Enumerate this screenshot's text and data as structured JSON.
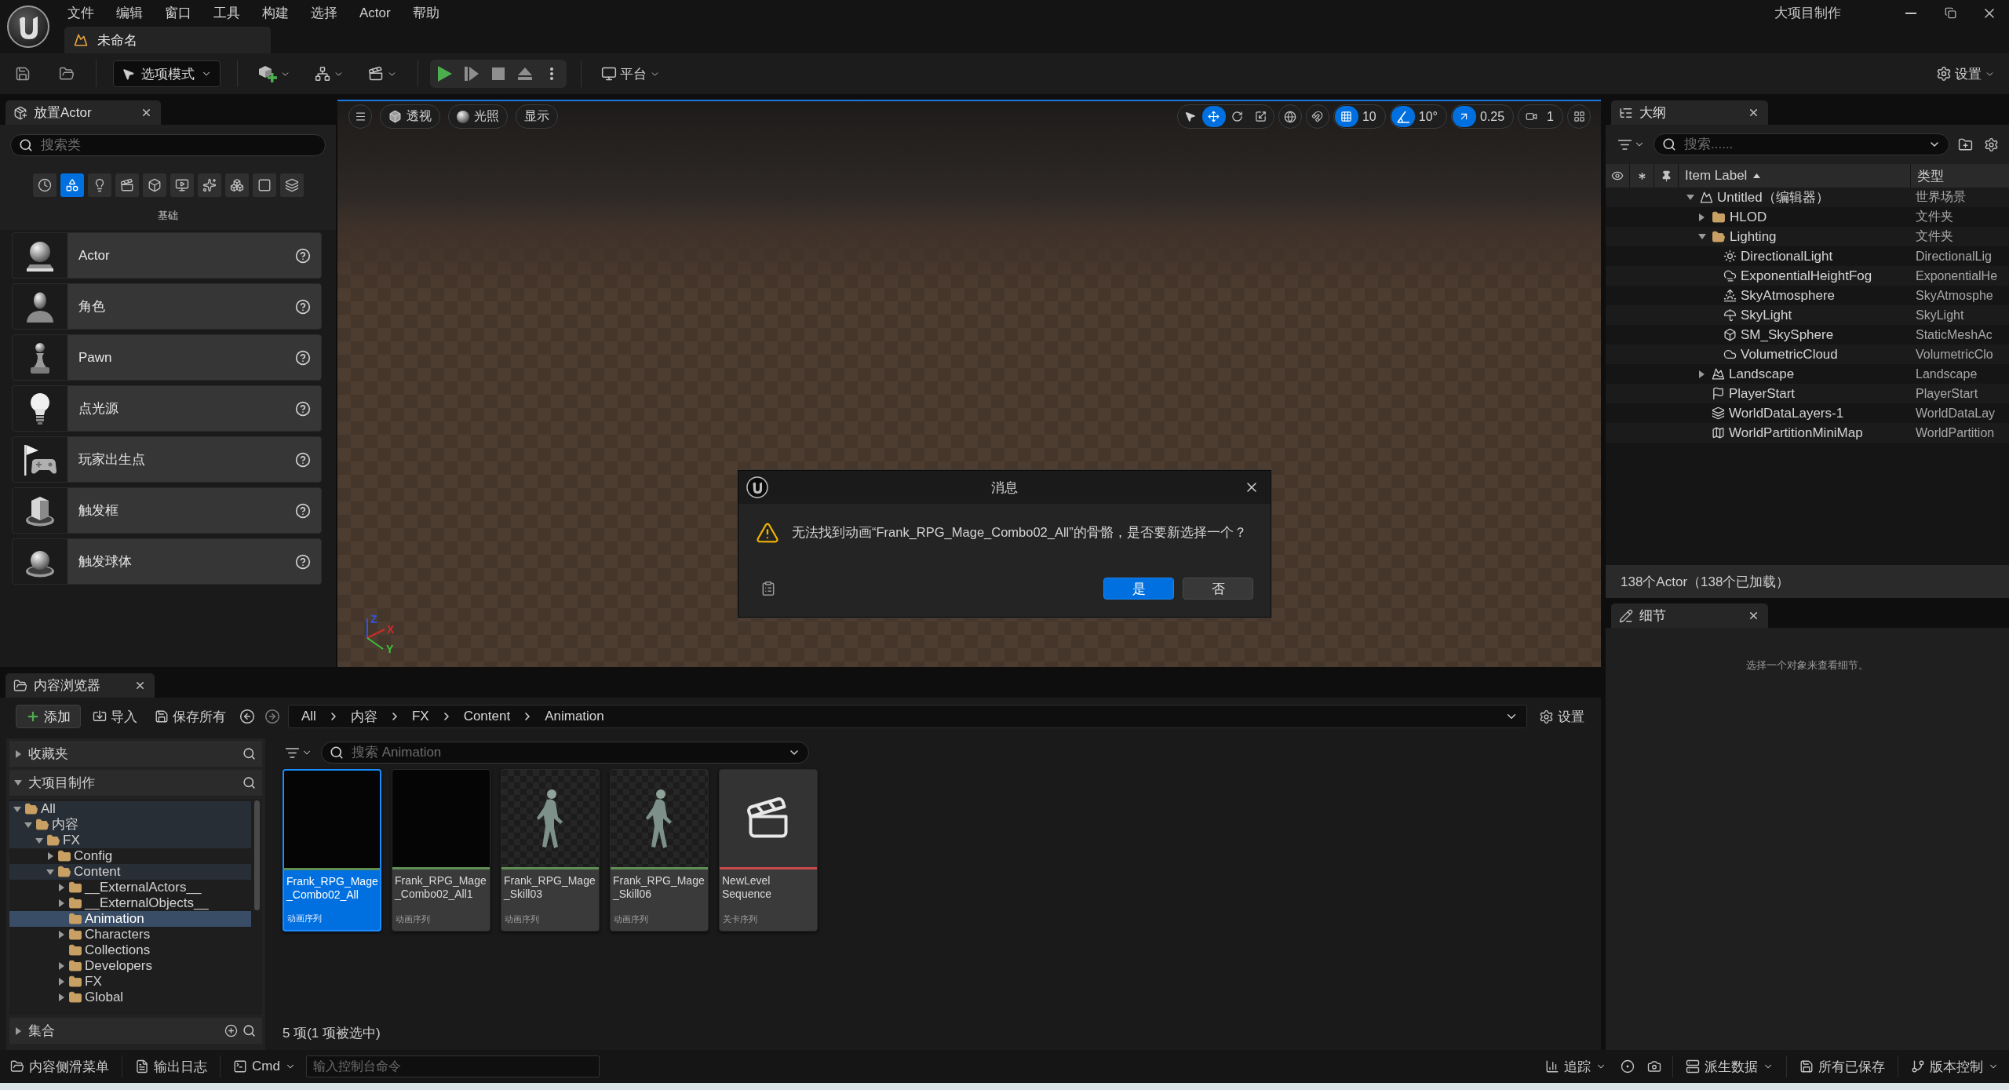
{
  "title_bar": {
    "menu": [
      "文件",
      "编辑",
      "窗口",
      "工具",
      "构建",
      "选择",
      "Actor",
      "帮助"
    ],
    "project": "大项目制作",
    "document_tab": "未命名"
  },
  "toolbar": {
    "mode": "选项模式",
    "platform": "平台",
    "settings": "设置"
  },
  "place_actors": {
    "tab": "放置Actor",
    "search_placeholder": "搜索类",
    "categories": [
      {
        "kind": "recent",
        "selected": false
      },
      {
        "kind": "basic",
        "selected": true
      },
      {
        "kind": "lights",
        "selected": false
      },
      {
        "kind": "cinematic",
        "selected": false
      },
      {
        "kind": "visual",
        "selected": false
      },
      {
        "kind": "media",
        "selected": false
      },
      {
        "kind": "effects",
        "selected": false
      },
      {
        "kind": "geometry",
        "selected": false
      },
      {
        "kind": "volumes",
        "selected": false
      },
      {
        "kind": "classes",
        "selected": false
      }
    ],
    "category_label": "基础",
    "items": [
      {
        "label": "Actor",
        "kind": "actor"
      },
      {
        "label": "角色",
        "kind": "character"
      },
      {
        "label": "Pawn",
        "kind": "pawn"
      },
      {
        "label": "点光源",
        "kind": "pointlight"
      },
      {
        "label": "玩家出生点",
        "kind": "playerstart"
      },
      {
        "label": "触发框",
        "kind": "triggerbox"
      },
      {
        "label": "触发球体",
        "kind": "triggersphere"
      }
    ]
  },
  "viewport": {
    "view_buttons": [
      {
        "kind": "perspective",
        "label": "透视"
      },
      {
        "kind": "lighting",
        "label": "光照"
      },
      {
        "kind": "show",
        "label": "显示"
      }
    ],
    "transform_tools": [
      {
        "kind": "select",
        "selected": false
      },
      {
        "kind": "move",
        "selected": true
      },
      {
        "kind": "rotate",
        "selected": false
      },
      {
        "kind": "scale",
        "selected": false
      }
    ],
    "snaps": [
      {
        "kind": "grid",
        "on": true,
        "value": "10"
      },
      {
        "kind": "angle",
        "on": true,
        "value": "10°"
      },
      {
        "kind": "scale",
        "on": true,
        "value": "0.25"
      },
      {
        "kind": "camera",
        "on": false,
        "value": "1"
      }
    ],
    "axis_labels": [
      "Z",
      "X",
      "Y"
    ],
    "dialog": {
      "title": "消息",
      "message": "无法找到动画“Frank_RPG_Mage_Combo02_All”的骨骼，是否要新选择一个？",
      "buttons": [
        {
          "label": "是",
          "kind": "primary"
        },
        {
          "label": "否",
          "kind": "secondary"
        }
      ]
    }
  },
  "outliner": {
    "tab": "大纲",
    "search_placeholder": "搜索......",
    "columns": [
      {
        "label": "Item Label",
        "sort_ascending": true
      },
      {
        "label": "类型"
      }
    ],
    "items": [
      {
        "label": "Untitled（编辑器）",
        "type": "世界场景",
        "kind": "world",
        "expanded": true,
        "children": [
          {
            "label": "HLOD",
            "type": "文件夹",
            "kind": "folder",
            "expanded": false
          },
          {
            "label": "Lighting",
            "type": "文件夹",
            "kind": "folder",
            "expanded": true,
            "children": [
              {
                "label": "DirectionalLight",
                "type": "DirectionalLig",
                "kind": "directional"
              },
              {
                "label": "ExponentialHeightFog",
                "type": "ExponentialHe",
                "kind": "fog"
              },
              {
                "label": "SkyAtmosphere",
                "type": "SkyAtmosphe",
                "kind": "atmosphere"
              },
              {
                "label": "SkyLight",
                "type": "SkyLight",
                "kind": "skylight"
              },
              {
                "label": "SM_SkySphere",
                "type": "StaticMeshAc",
                "kind": "mesh"
              },
              {
                "label": "VolumetricCloud",
                "type": "VolumetricClo",
                "kind": "cloud"
              }
            ]
          },
          {
            "label": "Landscape",
            "type": "Landscape",
            "kind": "landscape",
            "expanded": false
          },
          {
            "label": "PlayerStart",
            "type": "PlayerStart",
            "kind": "playerstart"
          },
          {
            "label": "WorldDataLayers-1",
            "type": "WorldDataLay",
            "kind": "datalayer"
          },
          {
            "label": "WorldPartitionMiniMap",
            "type": "WorldPartition",
            "kind": "minimap"
          }
        ]
      }
    ],
    "footer": "138个Actor（138个已加载）"
  },
  "details": {
    "tab": "细节",
    "empty_message": "选择一个对象来查看细节。"
  },
  "content_browser": {
    "tab": "内容浏览器",
    "buttons": [
      {
        "kind": "add",
        "label": "添加"
      },
      {
        "kind": "import",
        "label": "导入"
      },
      {
        "kind": "save",
        "label": "保存所有"
      }
    ],
    "path": [
      "All",
      "内容",
      "FX",
      "Content",
      "Animation"
    ],
    "settings": "设置",
    "sources": [
      {
        "kind": "favorites",
        "label": "收藏夹",
        "expanded": false
      },
      {
        "kind": "project",
        "label": "大项目制作",
        "expanded": true,
        "folders": [
          {
            "label": "All",
            "expanded": true,
            "selected": false,
            "children": [
              {
                "label": "内容",
                "expanded": true,
                "selected": false,
                "children": [
                  {
                    "label": "FX",
                    "expanded": true,
                    "selected": false,
                    "children": [
                      {
                        "label": "Config",
                        "expanded": false,
                        "selected": false
                      },
                      {
                        "label": "Content",
                        "expanded": true,
                        "selected": false,
                        "children": [
                          {
                            "label": "__ExternalActors__",
                            "expanded": false,
                            "selected": false
                          },
                          {
                            "label": "__ExternalObjects__",
                            "expanded": false,
                            "selected": false
                          },
                          {
                            "label": "Animation",
                            "selected": true
                          },
                          {
                            "label": "Characters",
                            "expanded": false,
                            "selected": false
                          },
                          {
                            "label": "Collections",
                            "selected": false
                          },
                          {
                            "label": "Developers",
                            "expanded": false,
                            "selected": false
                          },
                          {
                            "label": "FX",
                            "expanded": false,
                            "selected": false
                          },
                          {
                            "label": "Global",
                            "expanded": false,
                            "selected": false
                          }
                        ]
                      }
                    ]
                  }
                ]
              }
            ]
          }
        ]
      },
      {
        "kind": "collections",
        "label": "集合",
        "expanded": false
      }
    ],
    "search_placeholder": "搜索 Animation",
    "assets": [
      {
        "name_lines": [
          "Frank_RPG_Mage",
          "_Combo02_All"
        ],
        "type": "动画序列",
        "kind": "blank",
        "color": "#5f8f55",
        "selected": true
      },
      {
        "name_lines": [
          "Frank_RPG_Mage",
          "_Combo02_All1"
        ],
        "type": "动画序列",
        "kind": "blank",
        "color": "#5f8f55",
        "selected": false
      },
      {
        "name_lines": [
          "Frank_RPG_Mage",
          "_Skill03"
        ],
        "type": "动画序列",
        "kind": "figure",
        "color": "#5f8f55",
        "selected": false
      },
      {
        "name_lines": [
          "Frank_RPG_Mage",
          "_Skill06"
        ],
        "type": "动画序列",
        "kind": "figure",
        "color": "#5f8f55",
        "selected": false
      },
      {
        "name_lines": [
          "NewLevel",
          "Sequence"
        ],
        "type": "关卡序列",
        "kind": "clapperboard",
        "color": "#c94a4a",
        "selected": false
      }
    ],
    "status": "5 项(1 项被选中)"
  },
  "status_bar": {
    "left": [
      {
        "kind": "drawer",
        "label": "内容侧滑菜单",
        "dropdown": false
      },
      {
        "kind": "log",
        "label": "输出日志",
        "dropdown": false
      },
      {
        "kind": "cmd",
        "label": "Cmd",
        "dropdown": true
      }
    ],
    "console_placeholder": "输入控制台命令",
    "right": [
      {
        "kind": "trace",
        "label": "追踪",
        "dropdown": true
      },
      {
        "kind": "derived",
        "label": "派生数据",
        "dropdown": true
      },
      {
        "kind": "saved",
        "label": "所有已保存",
        "dropdown": false
      },
      {
        "kind": "revision",
        "label": "版本控制",
        "dropdown": true
      }
    ]
  }
}
